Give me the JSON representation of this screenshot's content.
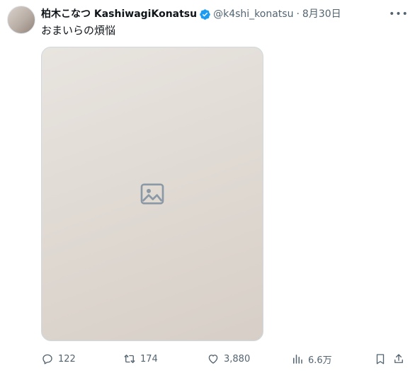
{
  "author": {
    "display_name": "柏木こなつ KashiwagiKonatsu",
    "handle": "@k4shi_konatsu",
    "separator": "·",
    "date": "8月30日",
    "verified": true
  },
  "tweet": {
    "text": "おまいらの煩悩",
    "has_media": true
  },
  "icons": {
    "more": "more-horizontal-icon",
    "reply": "reply-icon",
    "retweet": "retweet-icon",
    "like": "heart-icon",
    "views": "views-bar-chart-icon",
    "bookmark": "bookmark-icon",
    "share": "share-icon",
    "verified": "verified-badge-icon"
  },
  "metrics": {
    "replies": "122",
    "retweets": "174",
    "likes": "3,880",
    "views": "6.6万"
  },
  "colors": {
    "text": "#0f1419",
    "muted": "#536471",
    "verified": "#1d9bf0",
    "border": "#cfd9de"
  }
}
